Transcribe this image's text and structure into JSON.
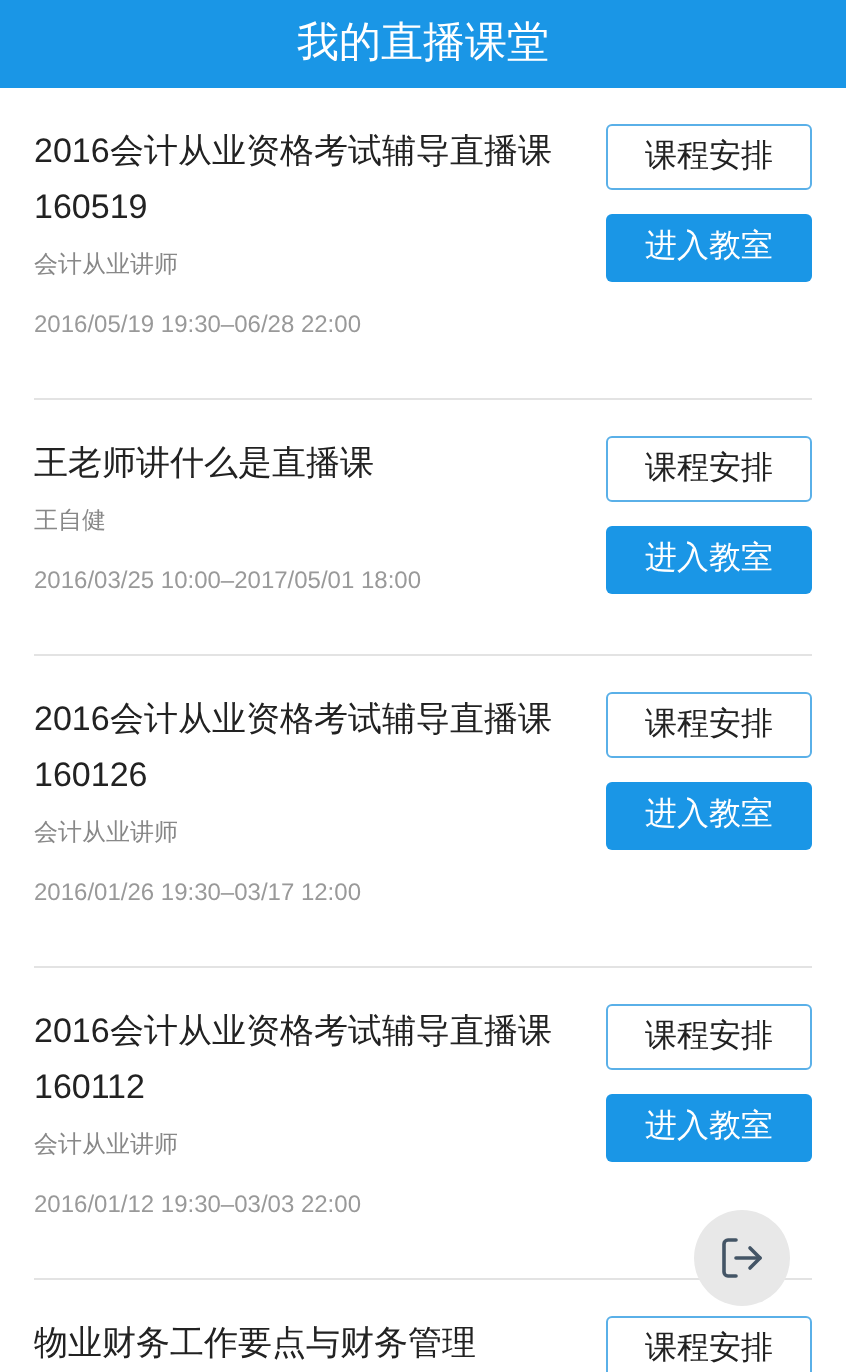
{
  "header": {
    "title": "我的直播课堂"
  },
  "courses": [
    {
      "title": "2016会计从业资格考试辅导直播课160519",
      "teacher": "会计从业讲师",
      "time": "2016/05/19 19:30–06/28 22:00",
      "schedule_button": "课程安排",
      "enter_button": "进入教室"
    },
    {
      "title": "王老师讲什么是直播课",
      "teacher": "王自健",
      "time": "2016/03/25 10:00–2017/05/01 18:00",
      "schedule_button": "课程安排",
      "enter_button": "进入教室"
    },
    {
      "title": "2016会计从业资格考试辅导直播课160126",
      "teacher": "会计从业讲师",
      "time": "2016/01/26 19:30–03/17 12:00",
      "schedule_button": "课程安排",
      "enter_button": "进入教室"
    },
    {
      "title": "2016会计从业资格考试辅导直播课160112",
      "teacher": "会计从业讲师",
      "time": "2016/01/12 19:30–03/03 22:00",
      "schedule_button": "课程安排",
      "enter_button": "进入教室"
    },
    {
      "title": "物业财务工作要点与财务管理",
      "schedule_button": "课程安排"
    }
  ]
}
